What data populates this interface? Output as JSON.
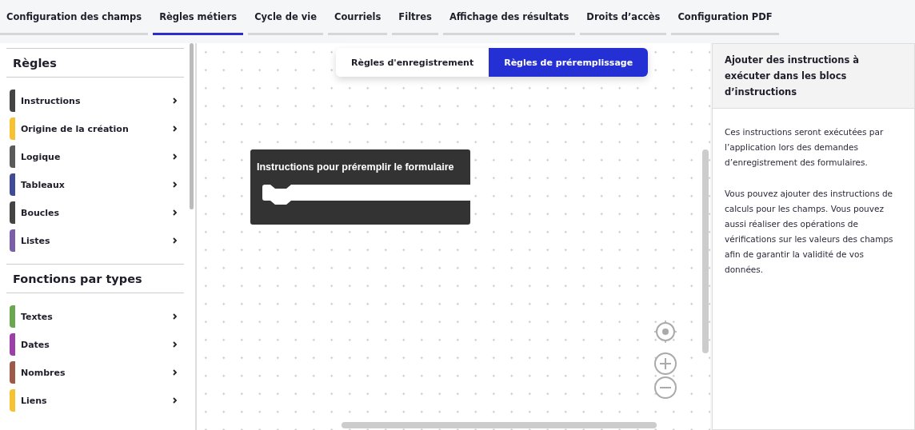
{
  "tabs": [
    {
      "label": "Configuration des champs",
      "selected": false
    },
    {
      "label": "Règles métiers",
      "selected": true
    },
    {
      "label": "Cycle de vie",
      "selected": false
    },
    {
      "label": "Courriels",
      "selected": false
    },
    {
      "label": "Filtres",
      "selected": false
    },
    {
      "label": "Affichage des résultats",
      "selected": false
    },
    {
      "label": "Droits d’accès",
      "selected": false
    },
    {
      "label": "Configuration PDF",
      "selected": false
    }
  ],
  "sidebar": {
    "sections": [
      {
        "title": "Règles",
        "items": [
          {
            "label": "Instructions",
            "color": "#444444"
          },
          {
            "label": "Origine de la création",
            "color": "#f6c232"
          },
          {
            "label": "Logique",
            "color": "#5a5a5a"
          },
          {
            "label": "Tableaux",
            "color": "#3f4b94"
          },
          {
            "label": "Boucles",
            "color": "#444444"
          },
          {
            "label": "Listes",
            "color": "#7a5fa8"
          }
        ]
      },
      {
        "title": "Fonctions par types",
        "items": [
          {
            "label": "Textes",
            "color": "#6aa84f"
          },
          {
            "label": "Dates",
            "color": "#9c3fa8"
          },
          {
            "label": "Nombres",
            "color": "#9c5a48"
          },
          {
            "label": "Liens",
            "color": "#f6c232"
          }
        ]
      }
    ]
  },
  "canvas": {
    "modes": [
      {
        "label": "Règles d'enregistrement",
        "selected": false
      },
      {
        "label": "Règles de préremplissage",
        "selected": true
      }
    ],
    "block": {
      "title": "Instructions pour préremplir le formulaire"
    }
  },
  "help": {
    "title": "Ajouter des instructions à exécuter dans les blocs d’instructions",
    "paragraphs": [
      "Ces instructions seront exécutées par l’application lors des demandes d’enregistrement des formulaires.",
      "Vous pouvez ajouter des instructions de calculs pour les champs. Vous pouvez aussi réaliser des opérations de vérifications sur les valeurs des champs afin de garantir la validité de vos données."
    ]
  }
}
